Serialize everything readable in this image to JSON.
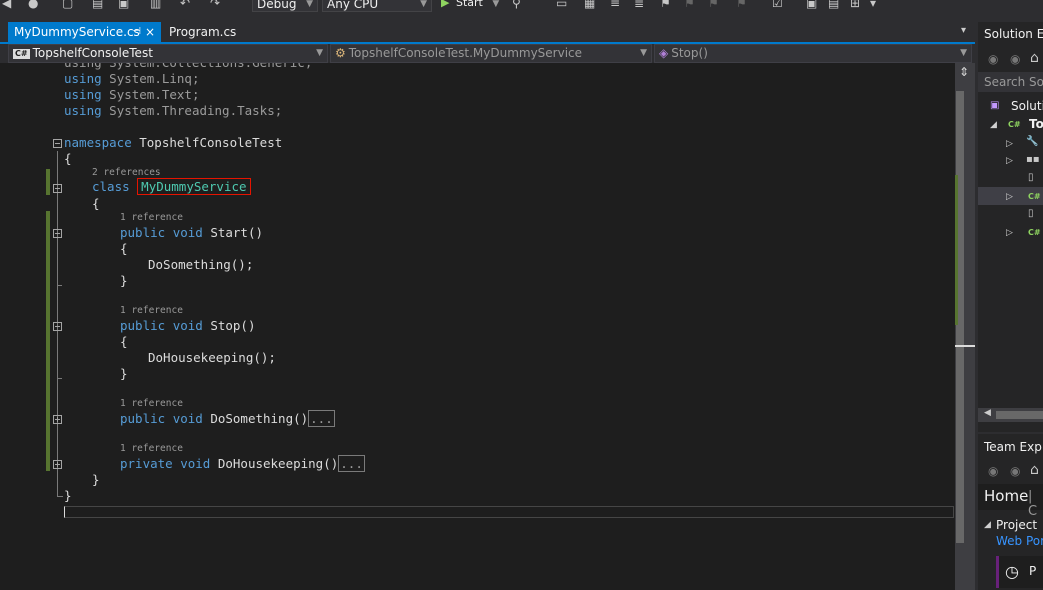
{
  "toolbar": {
    "config": "Debug",
    "platform": "Any CPU",
    "start_label": "Start"
  },
  "tabs": [
    {
      "label": "MyDummyService.cs",
      "pin": "⊣",
      "close": "×"
    },
    {
      "label": "Program.cs"
    }
  ],
  "tabs_overflow": "▾",
  "navbar": {
    "project": "TopshelfConsoleTest",
    "project_badge": "C#",
    "type": "TopshelfConsoleTest.MyDummyService",
    "member": "Stop()"
  },
  "code": {
    "using1": "using System.Collections.Generic;",
    "using2_kw": "using",
    "using2_rest": " System.Linq;",
    "using3_kw": "using",
    "using3_rest": " System.Text;",
    "using4_kw": "using",
    "using4_rest": " System.Threading.Tasks;",
    "ns_kw": "namespace",
    "ns_name": " TopshelfConsoleTest",
    "open_brace": "{",
    "close_brace": "}",
    "class_lens": "2 references",
    "class_kw": "class",
    "class_name": "MyDummyService",
    "start_lens": "1 reference",
    "public_kw": "public",
    "void_kw": "void",
    "private_kw": "private",
    "start_name": " Start()",
    "start_body": "DoSomething();",
    "stop_lens": "1 reference",
    "stop_name": " Stop()",
    "stop_body": "DoHousekeeping();",
    "dosomething_lens": "1 reference",
    "dosomething_name": " DoSomething()",
    "dohousekeeping_lens": "1 reference",
    "dohousekeeping_name": " DoHousekeeping()",
    "ellipsis": "..."
  },
  "solution_explorer": {
    "title": "Solution Ex",
    "search": "Search Solu",
    "root": "Solutio",
    "project": "To"
  },
  "team_explorer": {
    "title": "Team Explo",
    "home": "Home",
    "home_sep": "| C",
    "project_section": "Project",
    "web_portal": "Web Por",
    "item_letter": "P"
  }
}
